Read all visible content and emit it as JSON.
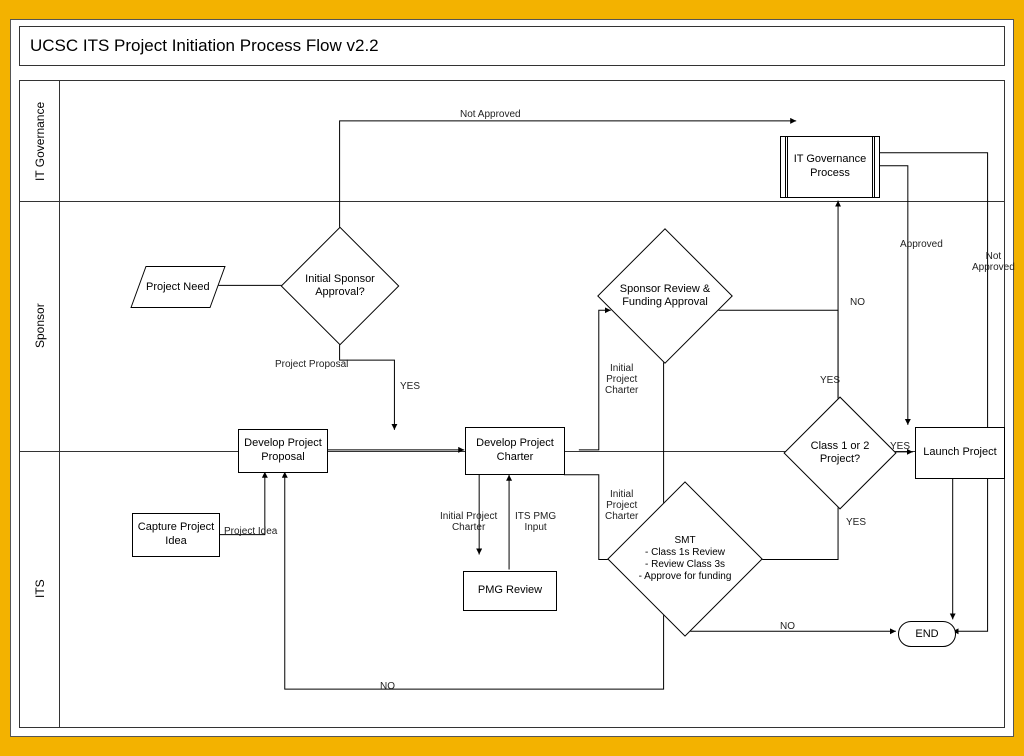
{
  "title": "UCSC ITS Project Initiation Process Flow v2.2",
  "lanes": {
    "gov": "IT Governance",
    "sponsor": "Sponsor",
    "its": "ITS"
  },
  "nodes": {
    "project_need": "Project Need",
    "initial_sponsor_approval": "Initial Sponsor Approval?",
    "develop_proposal": "Develop Project Proposal",
    "capture_idea": "Capture Project Idea",
    "develop_charter": "Develop Project Charter",
    "pmg_review": "PMG Review",
    "sponsor_review": "Sponsor Review & Funding Approval",
    "smt_review": "SMT\n- Class 1s Review\n- Review Class 3s\n- Approve for funding",
    "class12": "Class 1 or 2 Project?",
    "it_gov": "IT Governance Process",
    "launch": "Launch Project",
    "end": "END"
  },
  "labels": {
    "not_approved": "Not Approved",
    "yes": "YES",
    "no": "NO",
    "approved": "Approved",
    "not_approved2": "Not\nApproved",
    "project_proposal": "Project Proposal",
    "project_idea": "Project Idea",
    "initial_charter": "Initial\nProject\nCharter",
    "initial_charter2": "Initial\nProject\nCharter",
    "initial_charter3": "Initial Project\nCharter",
    "its_pmg_input": "ITS PMG\nInput"
  }
}
